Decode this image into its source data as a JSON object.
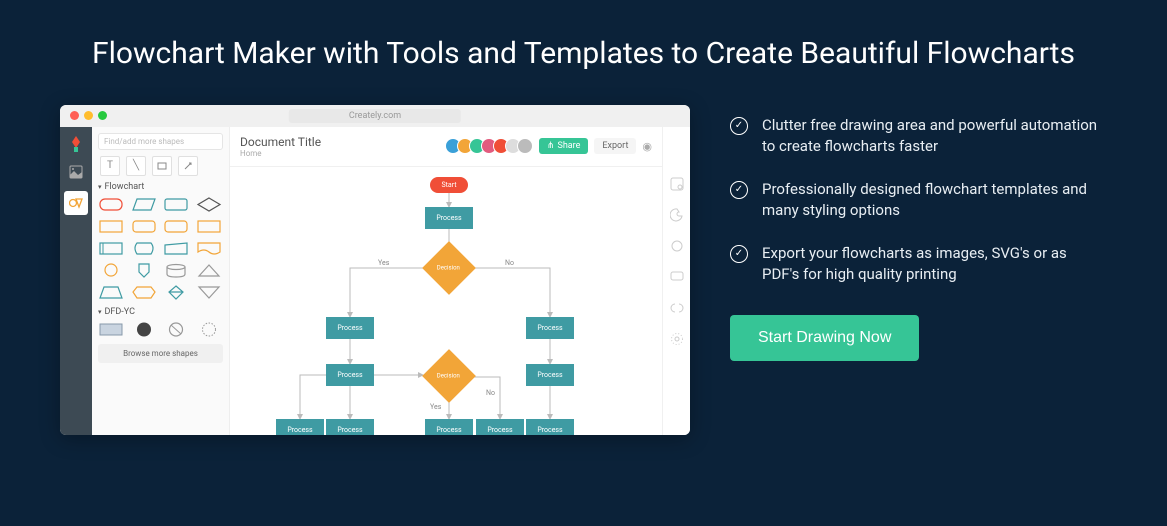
{
  "hero": {
    "title": "Flowchart Maker with Tools and Templates to Create Beautiful Flowcharts"
  },
  "features": [
    "Clutter free drawing area and powerful automation to create flowcharts faster",
    "Professionally designed flowchart templates and many styling options",
    "Export your flowcharts as images, SVG's or as PDF's for high quality printing"
  ],
  "cta": {
    "label": "Start Drawing Now"
  },
  "app": {
    "url": "Creately.com",
    "search_placeholder": "Find/add more shapes",
    "doc_title": "Document Title",
    "breadcrumb": "Home",
    "share_label": "Share",
    "export_label": "Export",
    "sections": {
      "flowchart": "Flowchart",
      "dfd": "DFD-YC"
    },
    "browse_more": "Browse more shapes",
    "avatars": [
      "#3aa0d8",
      "#f2a538",
      "#36c596",
      "#e25b7e",
      "#f04e37",
      "#ccc",
      "#888"
    ],
    "nodes": {
      "start": "Start",
      "process": "Process",
      "decision": "Decision",
      "yes": "Yes",
      "no": "No"
    }
  }
}
